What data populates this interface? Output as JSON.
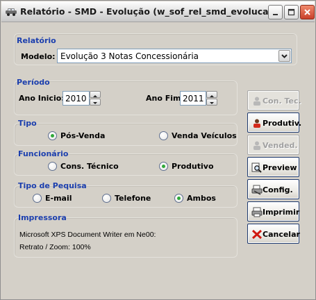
{
  "window": {
    "title": "Relatório - SMD - Evolução (w_sof_rel_smd_evolucao)"
  },
  "relatorio": {
    "group_title": "Relatório",
    "modelo_label": "Modelo:",
    "modelo_value": "Evolução 3 Notas Concessionária"
  },
  "periodo": {
    "group_title": "Período",
    "ano_inicio_label": "Ano Inicio:",
    "ano_inicio_value": "2010",
    "ano_fim_label": "Ano Fim:",
    "ano_fim_value": "2011"
  },
  "tipo": {
    "group_title": "Tipo",
    "options": [
      "Pós-Venda",
      "Venda Veículos"
    ],
    "selected": "Pós-Venda"
  },
  "funcionario": {
    "group_title": "Funcionário",
    "options": [
      "Cons. Técnico",
      "Produtivo"
    ],
    "selected": "Produtivo"
  },
  "tipo_pesquisa": {
    "group_title": "Tipo de Pequisa",
    "options": [
      "E-mail",
      "Telefone",
      "Ambos"
    ],
    "selected": "Ambos"
  },
  "impressora": {
    "group_title": "Impressora",
    "printer": "Microsoft XPS Document Writer em Ne00:",
    "mode": "Retrato / Zoom: 100%"
  },
  "buttons": [
    {
      "label": "Con. Tec.",
      "icon": "person-icon",
      "enabled": false
    },
    {
      "label": "Produtiv.",
      "icon": "person-red-icon",
      "enabled": true
    },
    {
      "label": "Vended.",
      "icon": "person-icon",
      "enabled": false
    },
    {
      "label": "Preview",
      "icon": "magnifier-icon",
      "enabled": true
    },
    {
      "label": "Config.",
      "icon": "printer-config-icon",
      "enabled": true
    },
    {
      "label": "Imprimir",
      "icon": "printer-icon",
      "enabled": true
    },
    {
      "label": "Cancelar",
      "icon": "red-x-icon",
      "enabled": true
    }
  ],
  "colors": {
    "group_title": "#1c3fae",
    "window_bg": "#d4d0c8",
    "radio_selected": "#2fa83a"
  }
}
